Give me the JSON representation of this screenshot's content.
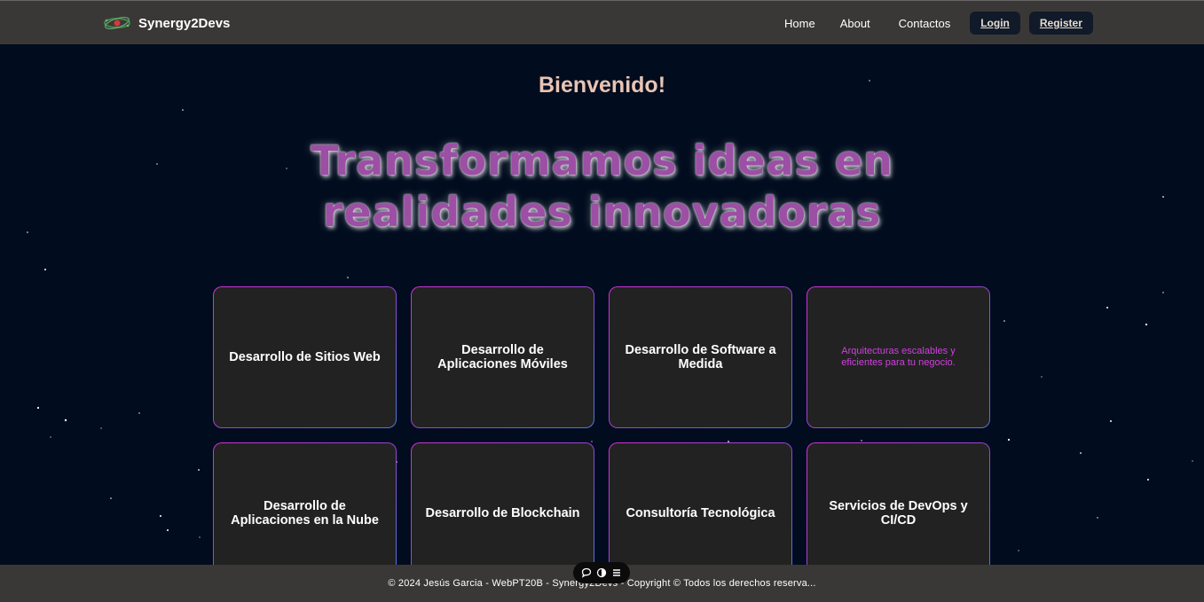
{
  "nav": {
    "brand": "Synergy2Devs",
    "links": [
      "Home",
      "About",
      "Contactos"
    ],
    "login_label": "Login",
    "register_label": "Register"
  },
  "hero": {
    "welcome": "Bienvenido!",
    "headline_line1": "Transformamos ideas en",
    "headline_line2": "realidades innovadoras"
  },
  "cards": [
    {
      "title": "Desarrollo de Sitios Web"
    },
    {
      "title": "Desarrollo de Aplicaciones Móviles"
    },
    {
      "title": "Desarrollo de Software a Medida"
    },
    {
      "description": "Arquitecturas escalables y eficientes para tu negocio."
    },
    {
      "title": "Desarrollo de Aplicaciones en la Nube"
    },
    {
      "title": "Desarrollo de Blockchain"
    },
    {
      "title": "Consultoría Tecnológica"
    },
    {
      "title": "Servicios de DevOps y CI/CD"
    }
  ],
  "footer": {
    "text": "© 2024 Jesús Garcia - WebPT20B - Synergy2Devs - Copyright © Todos los derechos reserva..."
  },
  "toolbar": {
    "icons": [
      "chat-icon",
      "contrast-icon",
      "menu-icon"
    ]
  },
  "colors": {
    "background": "#010c1e",
    "navbar": "#3a3836",
    "headline": "#9c4fa5",
    "welcome": "#e8c4b4",
    "card_bg": "#222222",
    "card_desc": "#d23fe0"
  }
}
